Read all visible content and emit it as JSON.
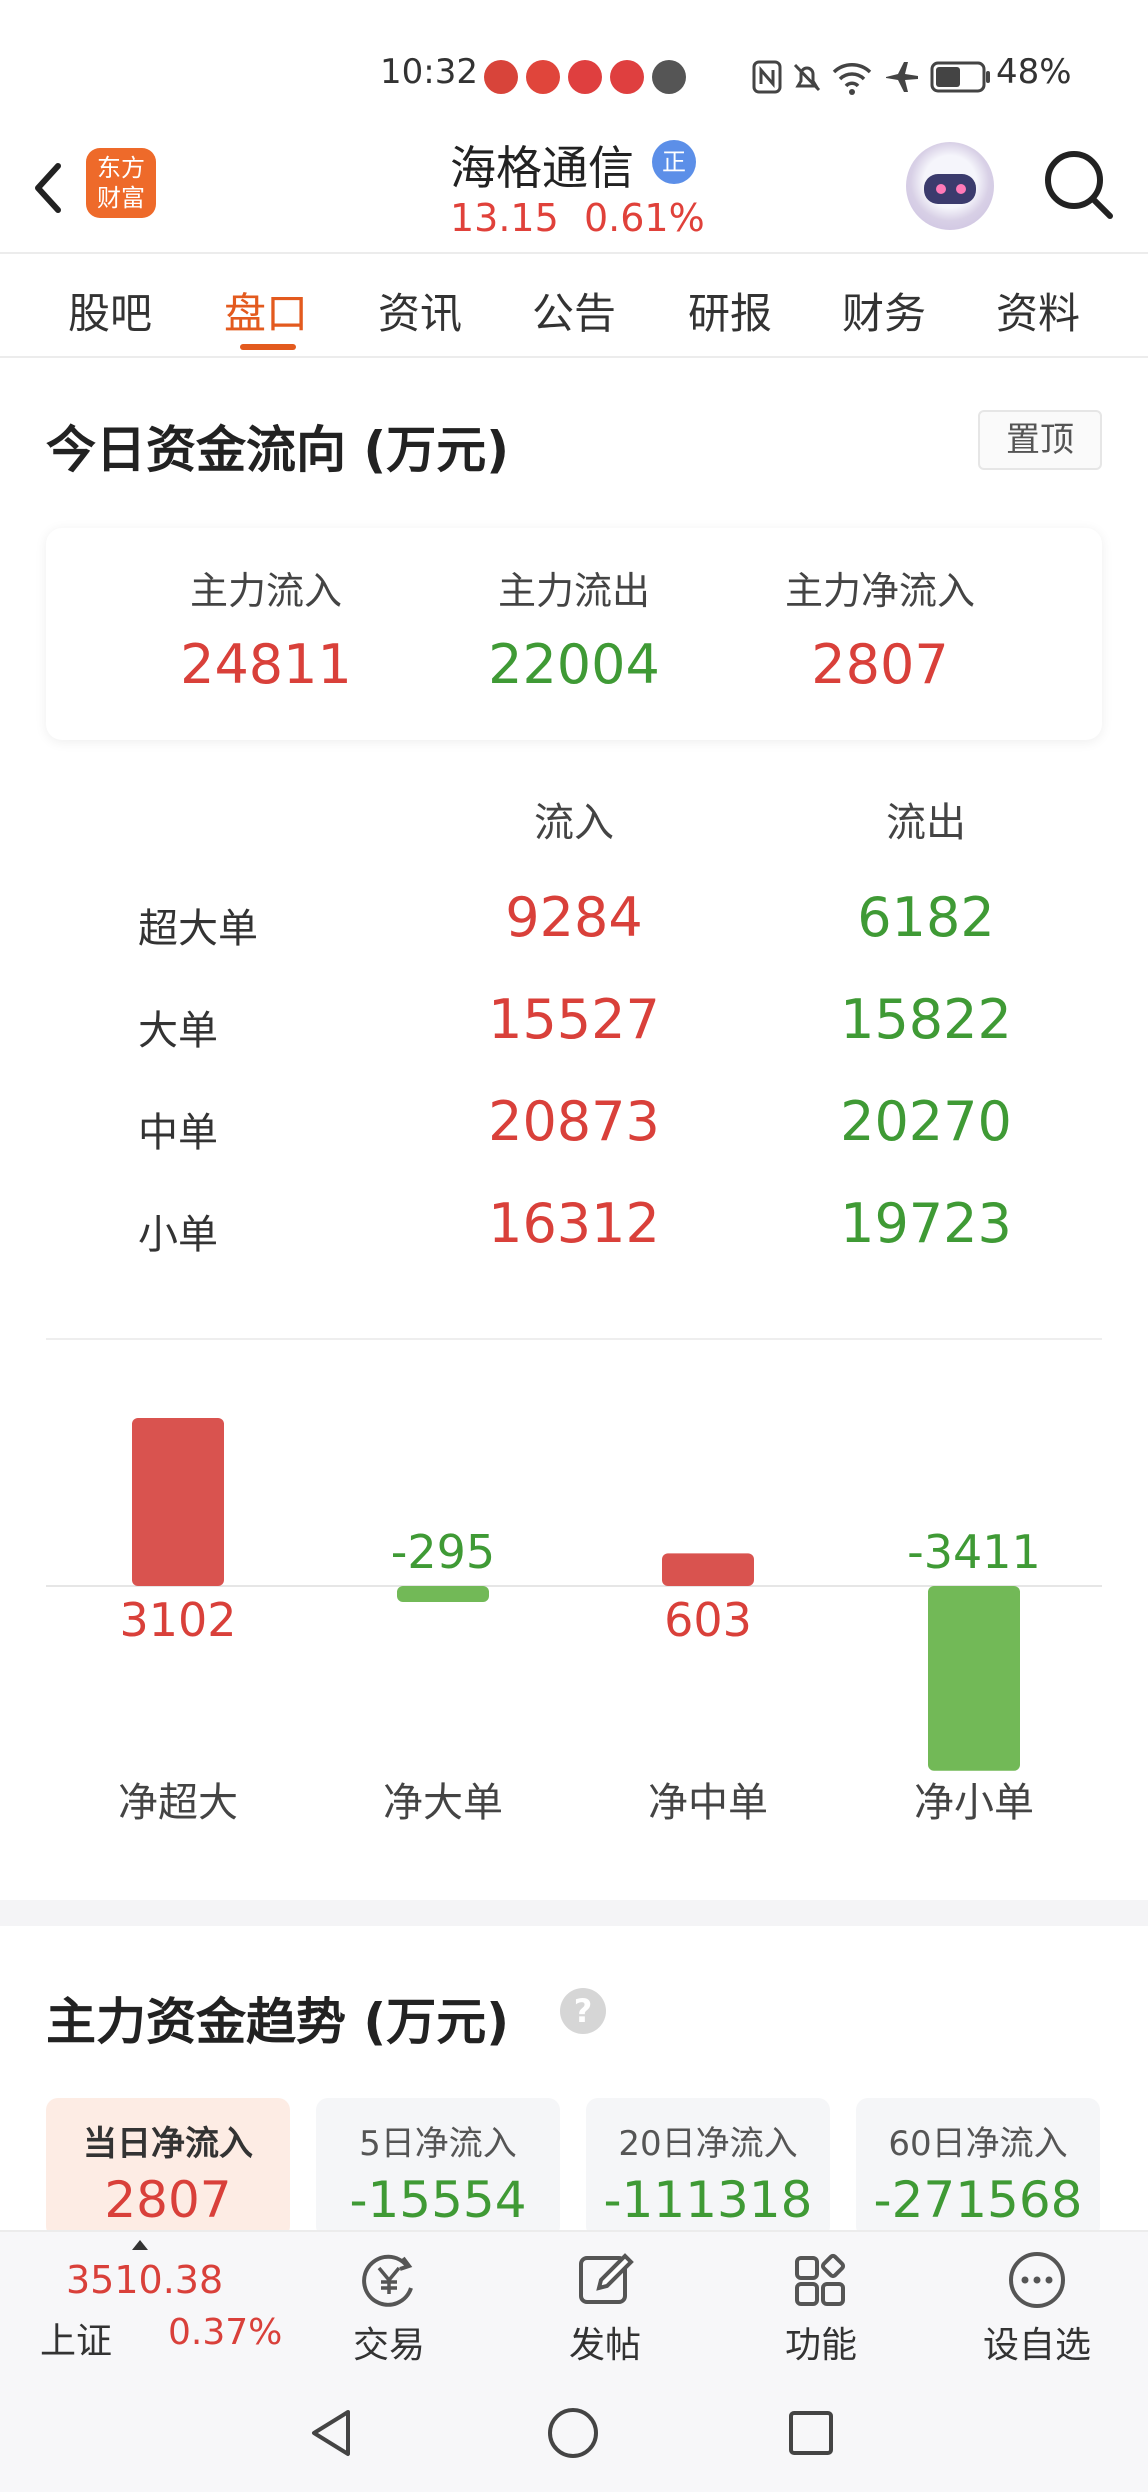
{
  "status_bar": {
    "time": "10:32",
    "battery": "48%"
  },
  "header": {
    "logo_line1": "东方",
    "logo_line2": "财富",
    "stock_name": "海格通信",
    "badge": "正",
    "price": "13.15",
    "change_pct": "0.61%"
  },
  "tabs": [
    {
      "label": "股吧"
    },
    {
      "label": "盘口"
    },
    {
      "label": "资讯"
    },
    {
      "label": "公告"
    },
    {
      "label": "研报"
    },
    {
      "label": "财务"
    },
    {
      "label": "资料"
    }
  ],
  "fund_flow": {
    "title": "今日资金流向 (万元)",
    "pin_label": "置顶",
    "summary": [
      {
        "label": "主力流入",
        "value": "24811",
        "color": "#d9403a"
      },
      {
        "label": "主力流出",
        "value": "22004",
        "color": "#3f9a35"
      },
      {
        "label": "主力净流入",
        "value": "2807",
        "color": "#d9403a"
      }
    ],
    "table": {
      "col_in": "流入",
      "col_out": "流出",
      "rows": [
        {
          "label": "超大单",
          "in": "9284",
          "out": "6182"
        },
        {
          "label": "大单",
          "in": "15527",
          "out": "15822"
        },
        {
          "label": "中单",
          "in": "20873",
          "out": "20270"
        },
        {
          "label": "小单",
          "in": "16312",
          "out": "19723"
        }
      ]
    }
  },
  "chart_data": {
    "type": "bar",
    "categories": [
      "净超大",
      "净大单",
      "净中单",
      "净小单"
    ],
    "values": [
      3102,
      -295,
      603,
      -3411
    ],
    "colors": {
      "positive": "#d9534f",
      "negative": "#72b957"
    },
    "title": "",
    "xlabel": "",
    "ylabel": ""
  },
  "trend": {
    "title": "主力资金趋势 (万元)",
    "help_icon": "question-icon",
    "cards": [
      {
        "label": "当日净流入",
        "value": "2807",
        "color": "#d9403a"
      },
      {
        "label": "5日净流入",
        "value": "-15554",
        "color": "#3f9a35"
      },
      {
        "label": "20日净流入",
        "value": "-111318",
        "color": "#3f9a35"
      },
      {
        "label": "60日净流入",
        "value": "-271568",
        "color": "#3f9a35"
      }
    ]
  },
  "bottom_bar": {
    "index_value": "3510.38",
    "index_name": "上证",
    "index_pct": "0.37%",
    "tools": [
      {
        "label": "交易",
        "icon": "trade-yen-icon"
      },
      {
        "label": "发帖",
        "icon": "edit-post-icon"
      },
      {
        "label": "功能",
        "icon": "grid-functions-icon"
      },
      {
        "label": "设自选",
        "icon": "more-dots-icon"
      }
    ]
  }
}
